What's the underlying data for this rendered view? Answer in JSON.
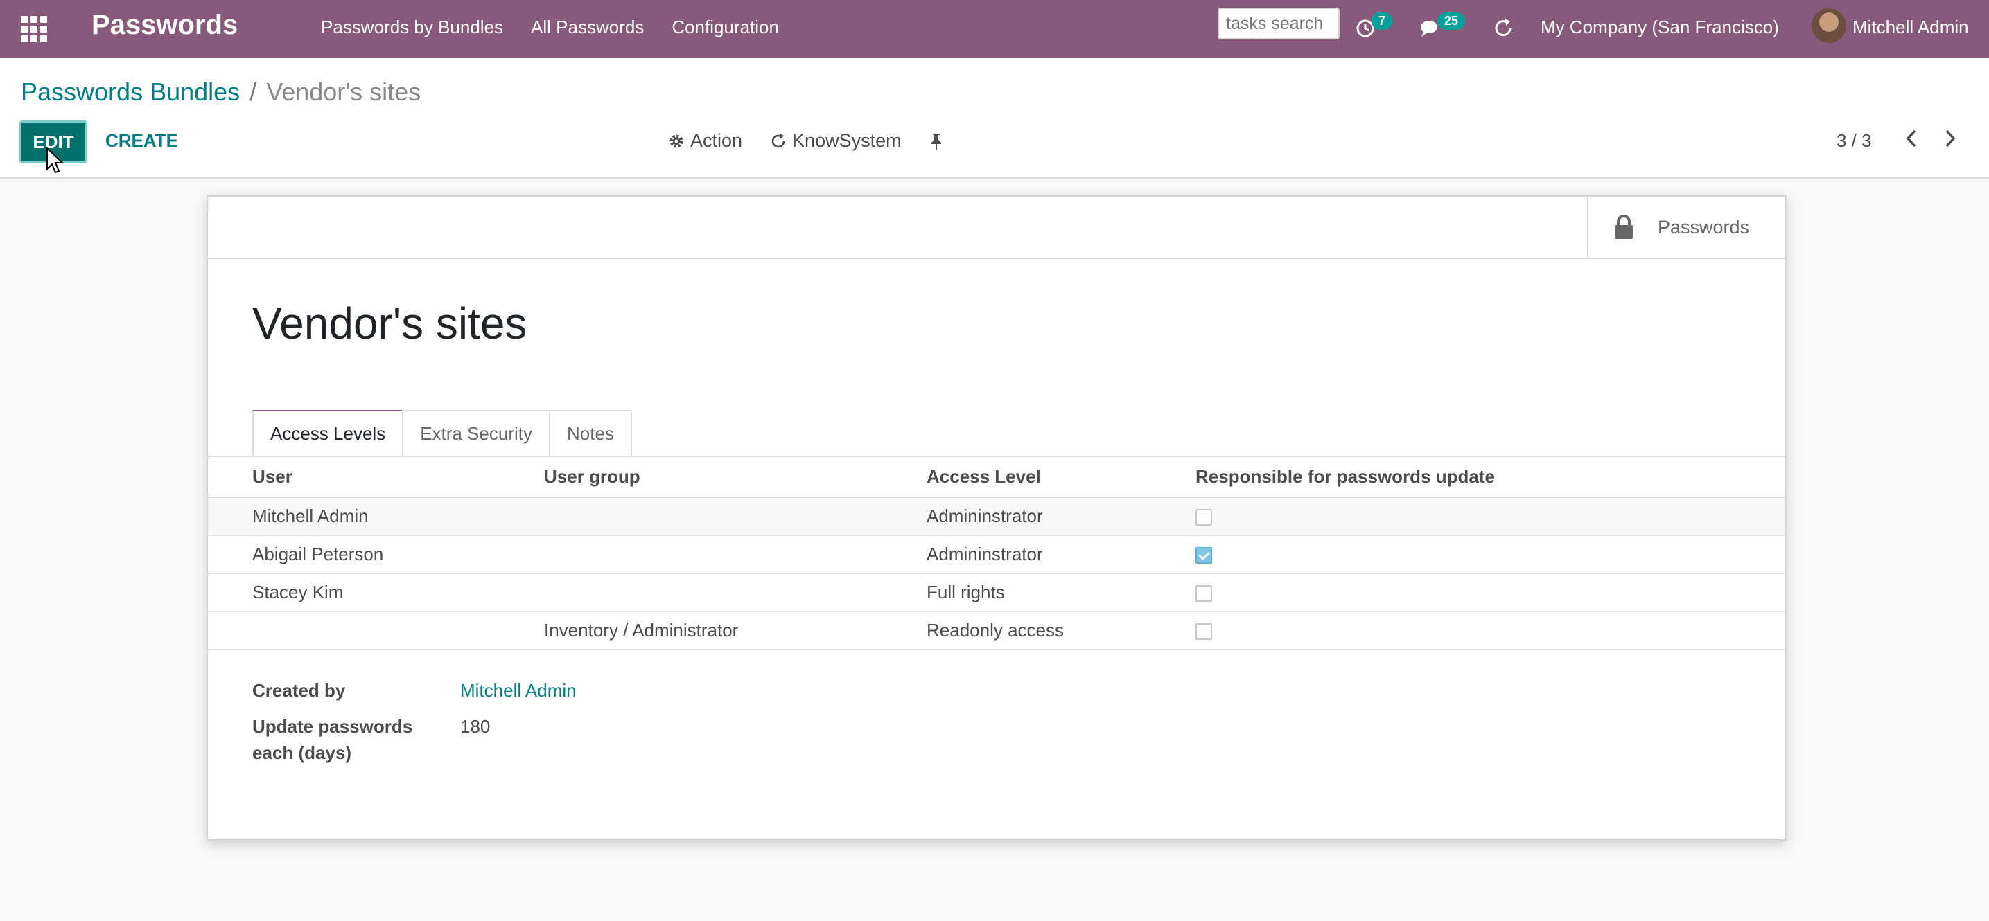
{
  "navbar": {
    "app_title": "Passwords",
    "menu": [
      "Passwords by Bundles",
      "All Passwords",
      "Configuration"
    ],
    "search_placeholder": "tasks search",
    "activity_count": "7",
    "message_count": "25",
    "company": "My Company (San Francisco)",
    "user": "Mitchell Admin",
    "colors": {
      "bar": "#875a7b",
      "badge": "#00a09d"
    }
  },
  "breadcrumb": {
    "parent": "Passwords Bundles",
    "separator": "/",
    "current": "Vendor's sites"
  },
  "control": {
    "edit_label": "EDIT",
    "create_label": "CREATE",
    "action_label": "Action",
    "knowsystem_label": "KnowSystem",
    "pager": "3 / 3"
  },
  "sheet": {
    "smart_button": "Passwords",
    "title": "Vendor's sites",
    "tabs": [
      "Access Levels",
      "Extra Security",
      "Notes"
    ],
    "table": {
      "headers": [
        "User",
        "User group",
        "Access Level",
        "Responsible for passwords update"
      ],
      "rows": [
        {
          "user": "Mitchell Admin",
          "group": "",
          "level": "Admininstrator",
          "responsible": false
        },
        {
          "user": "Abigail Peterson",
          "group": "",
          "level": "Admininstrator",
          "responsible": true
        },
        {
          "user": "Stacey Kim",
          "group": "",
          "level": "Full rights",
          "responsible": false
        },
        {
          "user": "",
          "group": "Inventory / Administrator",
          "level": "Readonly access",
          "responsible": false
        }
      ]
    },
    "fields": {
      "created_by_label": "Created by",
      "created_by_value": "Mitchell Admin",
      "update_label_line1": "Update passwords",
      "update_label_line2": "each (days)",
      "update_value": "180"
    }
  }
}
